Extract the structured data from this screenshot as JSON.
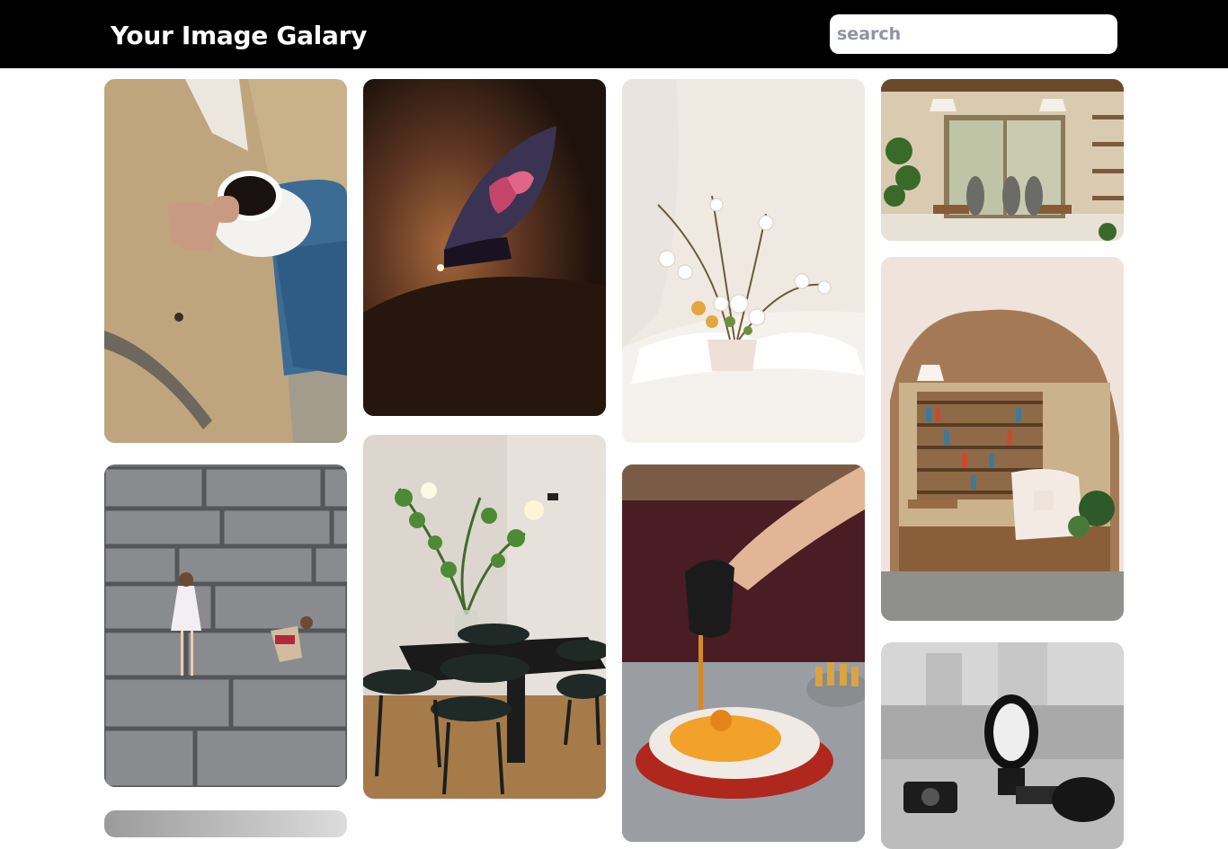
{
  "header": {
    "title": "Your Image Galary",
    "search_placeholder": "search"
  },
  "gallery": {
    "images": [
      {
        "subject": "coffee-cup-in-trench-coat"
      },
      {
        "subject": "kids-on-stone-wall"
      },
      {
        "subject": "gray-gradient-partial"
      },
      {
        "subject": "cave-arch-night-sky"
      },
      {
        "subject": "dining-table-with-plant"
      },
      {
        "subject": "white-flower-arrangement"
      },
      {
        "subject": "pouring-sauce-on-dish"
      },
      {
        "subject": "cafe-interior-windows"
      },
      {
        "subject": "arched-bookshelf-room"
      },
      {
        "subject": "black-white-camera"
      }
    ]
  }
}
